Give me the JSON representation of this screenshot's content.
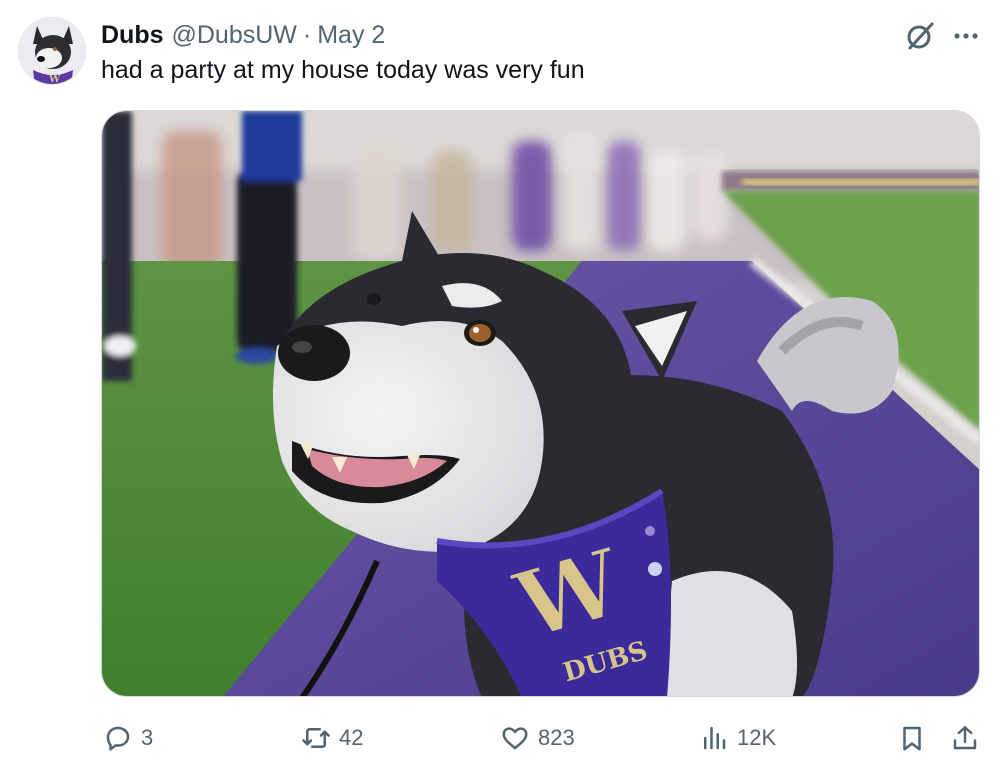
{
  "author": {
    "display_name": "Dubs",
    "handle": "@DubsUW",
    "separator": "·",
    "date": "May 2",
    "avatar_icon": "husky-avatar"
  },
  "tweet": {
    "text": "had a party at my house today was very fun",
    "media_description_icon": "husky-photo"
  },
  "bandana": {
    "letter": "W",
    "word": "DUBS"
  },
  "actions": {
    "replies": "3",
    "reposts": "42",
    "likes": "823",
    "views": "12K"
  },
  "colors": {
    "text": "#0f1419",
    "secondary": "#536471",
    "uw_purple": "#4b2e83",
    "uw_gold": "#b7a57a"
  }
}
